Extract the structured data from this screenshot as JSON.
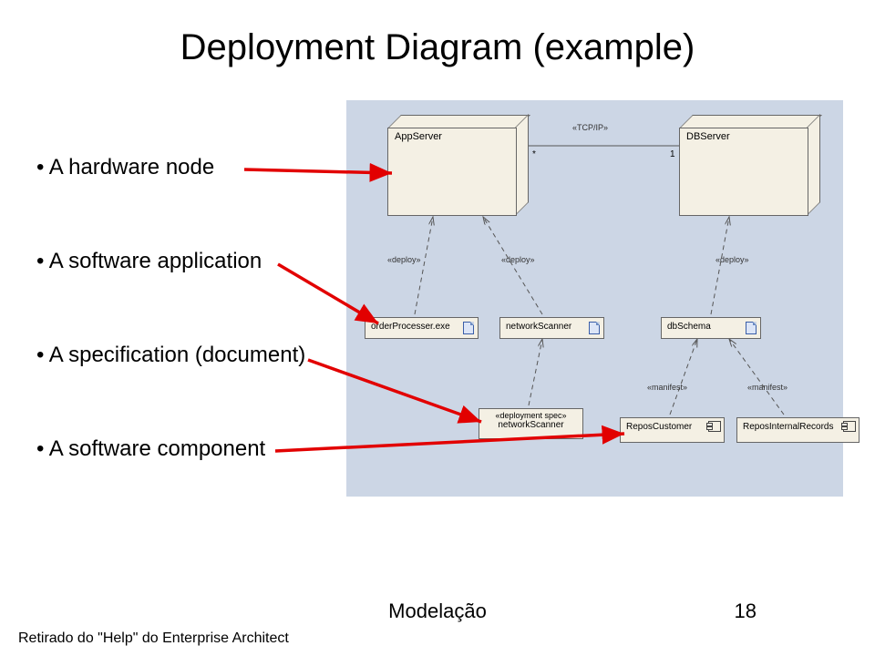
{
  "title": "Deployment Diagram (example)",
  "bullets": [
    "A hardware node",
    "A software application",
    "A specification (document)",
    "A software component"
  ],
  "footer": {
    "center": "Modelação",
    "page": "18"
  },
  "attribution": "Retirado do \"Help\" do Enterprise Architect",
  "diagram": {
    "nodes3d": [
      {
        "id": "appserver",
        "label": "AppServer"
      },
      {
        "id": "dbserver",
        "label": "DBServer"
      }
    ],
    "assoc": {
      "stereotype": "«TCP/IP»",
      "mult_left": "*",
      "mult_right": "1"
    },
    "artifacts": [
      {
        "id": "orderproc",
        "label": "orderProcesser.exe",
        "kind": "artifact"
      },
      {
        "id": "netscan",
        "label": "networkScanner",
        "kind": "artifact"
      },
      {
        "id": "dbschema",
        "label": "dbSchema",
        "kind": "artifact"
      }
    ],
    "spec": {
      "stereotype": "«deployment spec»",
      "label": "networkScanner"
    },
    "components": [
      {
        "id": "reposcust",
        "label": "ReposCustomer"
      },
      {
        "id": "reposint",
        "label": "ReposInternalRecords"
      }
    ],
    "edge_labels": {
      "deploy1": "«deploy»",
      "deploy2": "«deploy»",
      "deploy3": "«deploy»",
      "manifest1": "«manifest»",
      "manifest2": "«manifest»"
    }
  }
}
